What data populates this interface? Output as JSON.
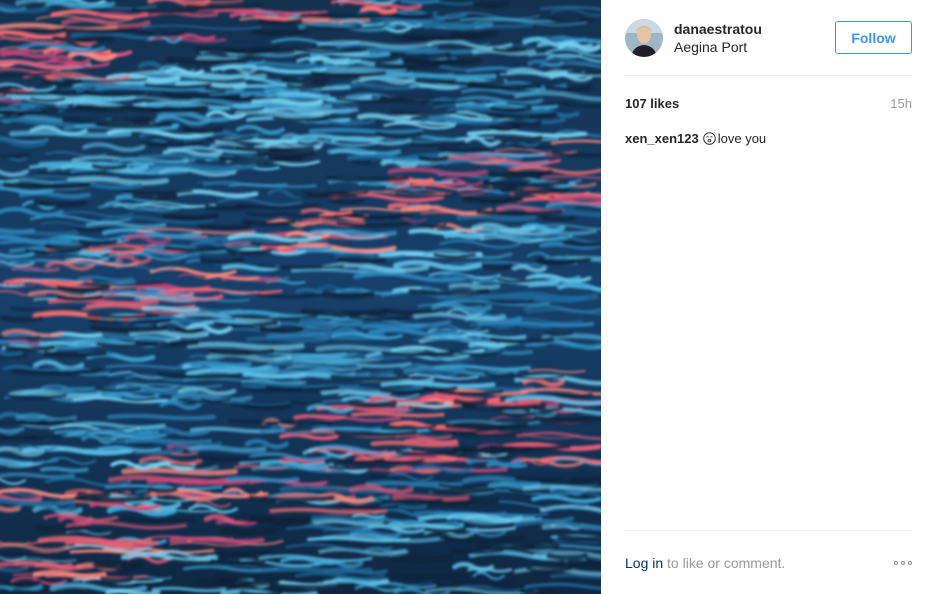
{
  "post": {
    "image_alt": "Rippling blue sea water reflecting pink sunset light",
    "author": {
      "username": "danaestratou",
      "location": "Aegina Port"
    },
    "follow_label": "Follow",
    "likes": "107 likes",
    "time": "15h",
    "comments": [
      {
        "username": "xen_xen123",
        "text": "love you",
        "emoji": "smiling-face-icon"
      }
    ]
  },
  "footer": {
    "login_link": "Log in",
    "login_rest": " to like or comment."
  },
  "colors": {
    "accent": "#3897f0",
    "link": "#003569",
    "muted": "#999999",
    "water_dark": "#15304e",
    "water_light": "#4fb6e0",
    "reflection": "#ff6f73"
  }
}
